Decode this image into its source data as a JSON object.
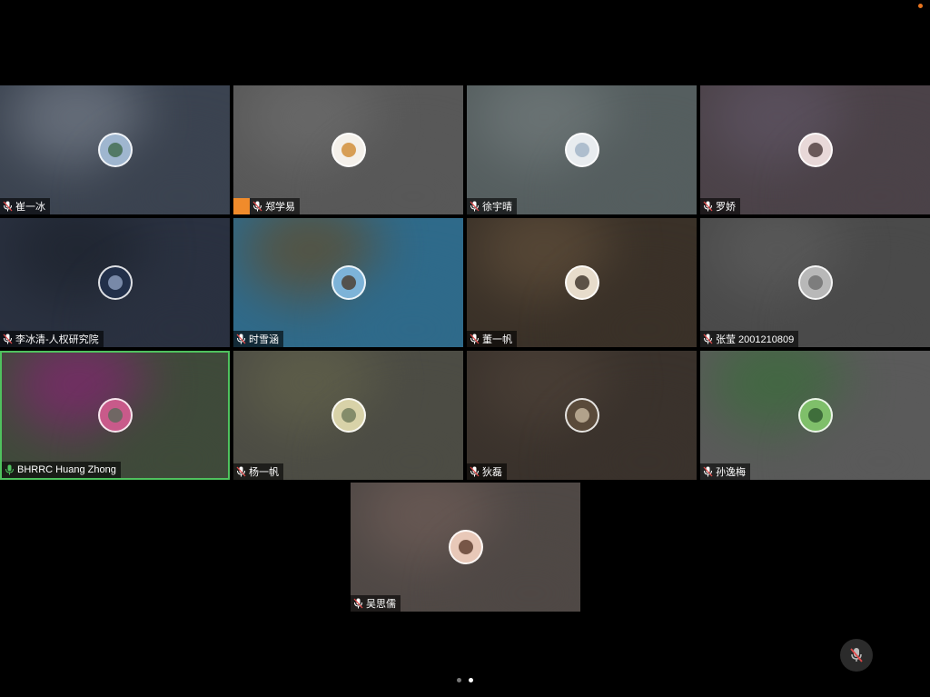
{
  "participants": [
    {
      "name": "崔一冰",
      "bg": [
        "#6c7480",
        "#3b4350"
      ],
      "avatar": [
        "#9fb6cf",
        "#3f6a4a"
      ],
      "user_icon": false,
      "muted": true
    },
    {
      "name": "郑学易",
      "bg": [
        "#6a6a6a",
        "#585858"
      ],
      "avatar": [
        "#f4f0ea",
        "#d08a2f"
      ],
      "user_icon": true,
      "muted": true
    },
    {
      "name": "徐宇晴",
      "bg": [
        "#6d7677",
        "#555e5f"
      ],
      "avatar": [
        "#e8ecef",
        "#9fb3c6"
      ],
      "user_icon": false,
      "muted": true
    },
    {
      "name": "罗娇",
      "bg": [
        "#5c5260",
        "#4b4248"
      ],
      "avatar": [
        "#e8d8d8",
        "#4a3a3a"
      ],
      "user_icon": false,
      "muted": true
    },
    {
      "name": "李冰清-人权研究院",
      "bg": [
        "#1f2530",
        "#2a3140"
      ],
      "avatar": [
        "#22304a",
        "#8ea0bf"
      ],
      "user_icon": false,
      "muted": true
    },
    {
      "name": "时雪涵",
      "bg": [
        "#5a5038",
        "#2f6a8a"
      ],
      "avatar": [
        "#7db3d8",
        "#4a3a2a"
      ],
      "user_icon": false,
      "muted": true
    },
    {
      "name": "董一帆",
      "bg": [
        "#5a4a38",
        "#3a3128"
      ],
      "avatar": [
        "#e7dccb",
        "#3a2f25"
      ],
      "user_icon": false,
      "muted": true
    },
    {
      "name": "张莹 2001210809",
      "bg": [
        "#5a5a5a",
        "#4a4a4a"
      ],
      "avatar": [
        "#b8b8b8",
        "#6e6e6e"
      ],
      "user_icon": false,
      "muted": true
    },
    {
      "name": "BHRRC Huang Zhong",
      "bg": [
        "#7a2a6a",
        "#3f4a3a"
      ],
      "avatar": [
        "#c85a8a",
        "#5a6a5a"
      ],
      "user_icon": false,
      "muted": false,
      "active": true
    },
    {
      "name": "杨一帆",
      "bg": [
        "#5f5f4a",
        "#4c4c44"
      ],
      "avatar": [
        "#d8d2a8",
        "#6f7a5a"
      ],
      "user_icon": false,
      "muted": true
    },
    {
      "name": "狄磊",
      "bg": [
        "#4a3f36",
        "#3a322c"
      ],
      "avatar": [
        "#5a4a3a",
        "#c8b8a0"
      ],
      "user_icon": false,
      "muted": true
    },
    {
      "name": "孙逸梅",
      "bg": [
        "#3f6a3f",
        "#5a5a5a"
      ],
      "avatar": [
        "#7fbf6a",
        "#2f5a2f"
      ],
      "user_icon": false,
      "muted": true
    },
    {
      "name": "吴思儒",
      "bg": [
        "#6a5a55",
        "#4f4845"
      ],
      "avatar": [
        "#e8c8b8",
        "#5a3a2a"
      ],
      "user_icon": false,
      "muted": true
    }
  ],
  "pagination": {
    "pages": 2,
    "current": 2
  },
  "colors": {
    "accent_active_border": "#4fc25e",
    "user_icon": "#f08b2b",
    "muted_mic": "#e04a4a",
    "status_dot": "#e8741e"
  },
  "icons": {
    "mic": "mic-muted-icon",
    "mute_button": "mic-muted-icon",
    "user": "user-icon"
  }
}
